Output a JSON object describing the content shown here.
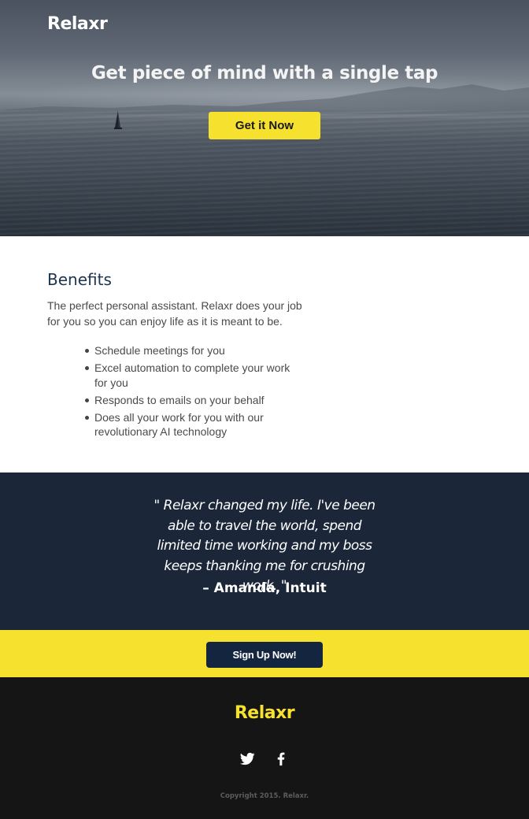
{
  "brand": {
    "name": "Relaxr",
    "accent_color": "#f7e12f",
    "navy_color": "#14263f"
  },
  "hero": {
    "title": "Get piece of mind with a single tap",
    "cta_label": "Get it Now"
  },
  "benefits": {
    "title": "Benefits",
    "description": "The perfect personal assistant. Relaxr does your job for you so you can enjoy life as it is meant to be.",
    "items": [
      "Schedule meetings for you",
      "Excel automation to complete your work for you",
      "Responds to emails on your behalf",
      "Does all your work for you with our revolutionary AI technology"
    ]
  },
  "testimonial": {
    "quote": "\" Relaxr changed my life. I've been able to travel the world, spend limited time working and my boss keeps thanking me for crushing work. \"",
    "author": "– Amanda, Intuit"
  },
  "cta": {
    "label": "Sign Up Now!"
  },
  "footer": {
    "logo": "Relaxr",
    "social": [
      "twitter-icon",
      "facebook-icon"
    ],
    "copyright": "Copyright 2015. Relaxr."
  }
}
